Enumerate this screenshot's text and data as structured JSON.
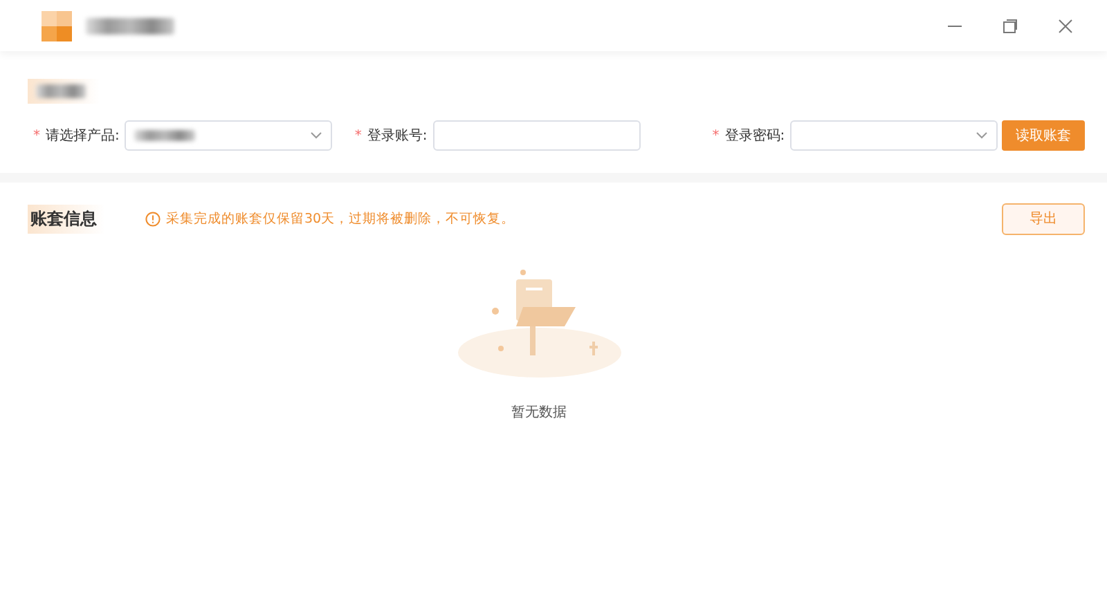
{
  "form": {
    "fields": [
      {
        "kind": "select",
        "mark": "*",
        "label": "请选择产品:"
      },
      {
        "kind": "input",
        "mark": "*",
        "label": "登录账号:"
      },
      {
        "kind": "select",
        "mark": "*",
        "label": "登录密码:"
      }
    ],
    "button": "读取账套"
  },
  "accounts": {
    "title": "账套信息",
    "notice": "采集完成的账套仅保留30天，过期将被删除，不可恢复。",
    "export_button": "导出",
    "empty_text": "暂无数据"
  }
}
